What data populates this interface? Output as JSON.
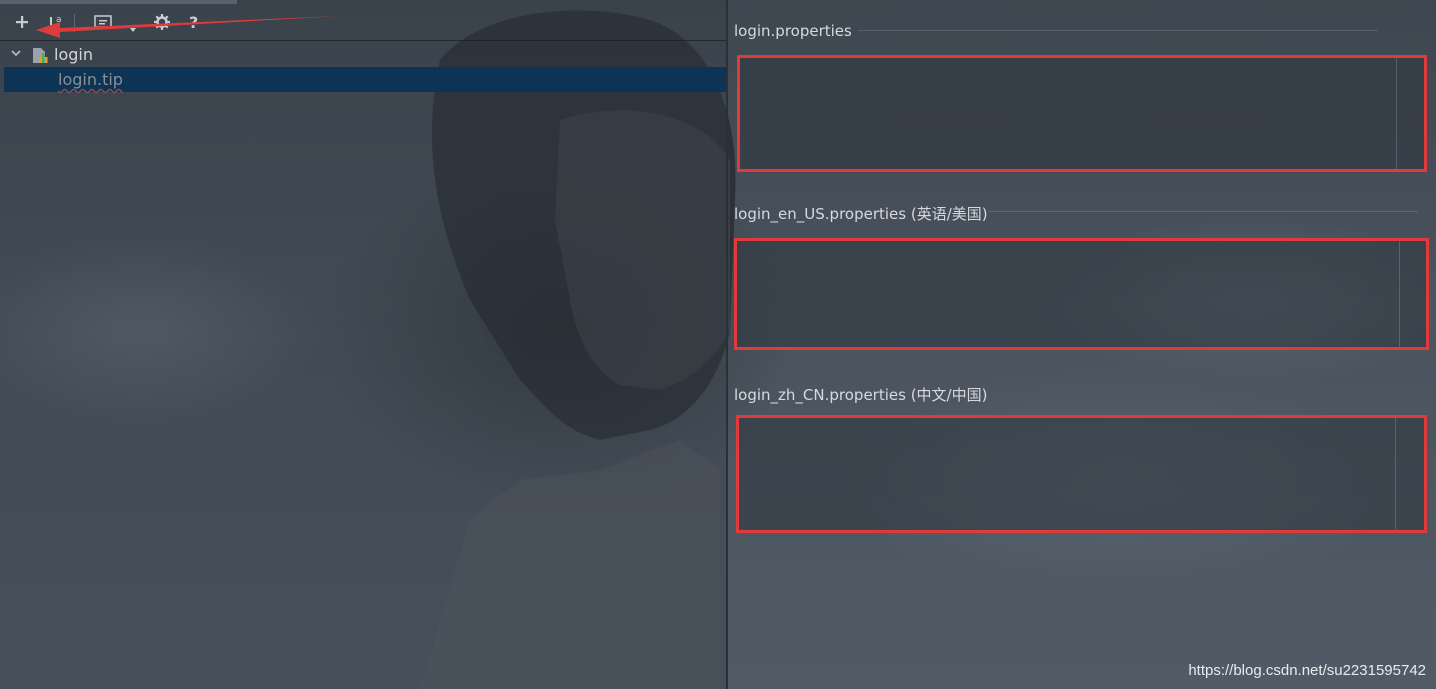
{
  "toolbar": {
    "buttons": [
      {
        "name": "add",
        "icon": "plus-icon",
        "glyph": "+"
      },
      {
        "name": "sort-alphabetically",
        "icon": "sort-alpha-icon",
        "glyph": "a"
      },
      {
        "name": "group",
        "icon": "group-icon",
        "glyph": "[=]"
      },
      {
        "name": "settings",
        "icon": "gear-icon",
        "glyph": "⚙"
      },
      {
        "name": "help",
        "icon": "help-icon",
        "glyph": "?"
      }
    ]
  },
  "tree": {
    "root_label": "login",
    "children": [
      {
        "label": "login.tip",
        "selected": true
      }
    ]
  },
  "editors": [
    {
      "label": "login.properties"
    },
    {
      "label": "login_en_US.properties (英语/美国)"
    },
    {
      "label": "login_zh_CN.properties (中文/中国)"
    }
  ],
  "watermark": "https://blog.csdn.net/su2231595742",
  "colors": {
    "selection": "#0d3454",
    "annotation_red": "#e03b3b"
  }
}
